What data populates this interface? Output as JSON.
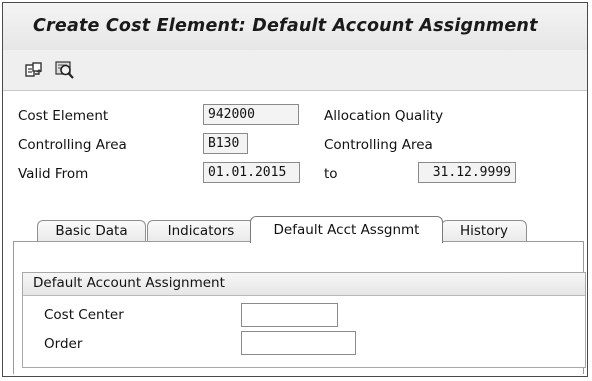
{
  "window": {
    "title": "Create Cost Element: Default Account Assignment"
  },
  "toolbar": {
    "icons": [
      "display-switch-icon",
      "find-icon"
    ]
  },
  "header": {
    "cost_element_label": "Cost Element",
    "cost_element_value": "942000",
    "allocation_quality": "Allocation Quality",
    "controlling_area_label": "Controlling Area",
    "controlling_area_value": "B130",
    "controlling_area_text": "Controlling Area",
    "valid_from_label": "Valid From",
    "valid_from_value": "01.01.2015",
    "to_label": "to",
    "valid_to_value": "31.12.9999"
  },
  "tabs": [
    {
      "label": "Basic Data"
    },
    {
      "label": "Indicators"
    },
    {
      "label": "Default Acct Assgnmt"
    },
    {
      "label": "History"
    }
  ],
  "active_tab": "Default Acct Assgnmt",
  "group": {
    "title": "Default Account Assignment",
    "cost_center_label": "Cost Center",
    "cost_center_value": "",
    "order_label": "Order",
    "order_value": ""
  }
}
